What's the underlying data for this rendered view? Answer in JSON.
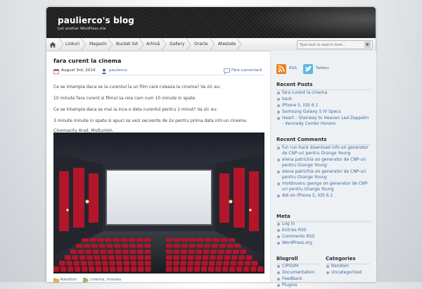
{
  "header": {
    "blog_title": "paulierco's blog",
    "tagline": "Just another WordPress site"
  },
  "nav": {
    "home_icon": "home-icon",
    "items": [
      "Linkuri",
      "Magazin",
      "Bucket list",
      "Arhivă",
      "Gallery",
      "Oracle",
      "Atestate"
    ],
    "search_placeholder": "Type text to search here..."
  },
  "post": {
    "title": "fara curent la cinema",
    "date": "August 3rd, 2014",
    "author": "paulierco",
    "comments": "Fără comentarii",
    "paragraphs": [
      "Ce se intampla daca se ia curentul la un film care ruleaza la cinema? Va zic eu:",
      "10 minute fara curent si filmul sa reia cam cum 10 minute in spate.",
      "Ce se intampla daca se mai ia inca o data curentul pentru 1 minut? Va zic eu:",
      "3 minute minute in spate si apuci sa vezi secvente de 2x pentru prima data intr-un cinema.",
      "Cinemacity Arad. Multumim."
    ],
    "category": "Random",
    "tags": "cinema, movies"
  },
  "sidebar": {
    "social": {
      "rss": "RSS",
      "twitter": "Twitter"
    },
    "recent_posts": {
      "title": "Recent Posts",
      "items": [
        "fara curent la cinema",
        "back",
        "iPhone 5, iOS 6.1",
        "Samsung Galaxy S IV Specs",
        "Heart – Stairway to Heaven Led Zeppelin – Kennedy Center Honors"
      ]
    },
    "recent_comments": {
      "title": "Recent Comments",
      "items": [
        {
          "author": "fun run hack download info",
          "on": "on",
          "post": "generator de CNP-uri pentru Orange Young"
        },
        {
          "author": "elena patrichia",
          "on": "on",
          "post": "generator de CNP-uri pentru Orange Young"
        },
        {
          "author": "elena patrichia",
          "on": "on",
          "post": "generator de CNP-uri pentru Orange Young"
        },
        {
          "author": "moldovanu george",
          "on": "on",
          "post": "generator de CNP-uri pentru Orange Young"
        },
        {
          "author": "Adi",
          "on": "on",
          "post": "iPhone 5, iOS 6.1"
        }
      ]
    },
    "meta": {
      "title": "Meta",
      "items": [
        "Log in",
        "Entries RSS",
        "Comments RSS",
        "WordPress.org"
      ]
    },
    "blogroll": {
      "title": "Blogroll",
      "items": [
        "CIPGSM",
        "Documentation",
        "Feedback",
        "Plugins"
      ]
    },
    "categories": {
      "title": "Categories",
      "items": [
        "Random",
        "Uncategorized"
      ]
    }
  },
  "colors": {
    "link": "#3a6aa0",
    "header_bg": "#222222",
    "seat_red": "#b3152b",
    "sidebar_bg": "#eef1f4"
  }
}
